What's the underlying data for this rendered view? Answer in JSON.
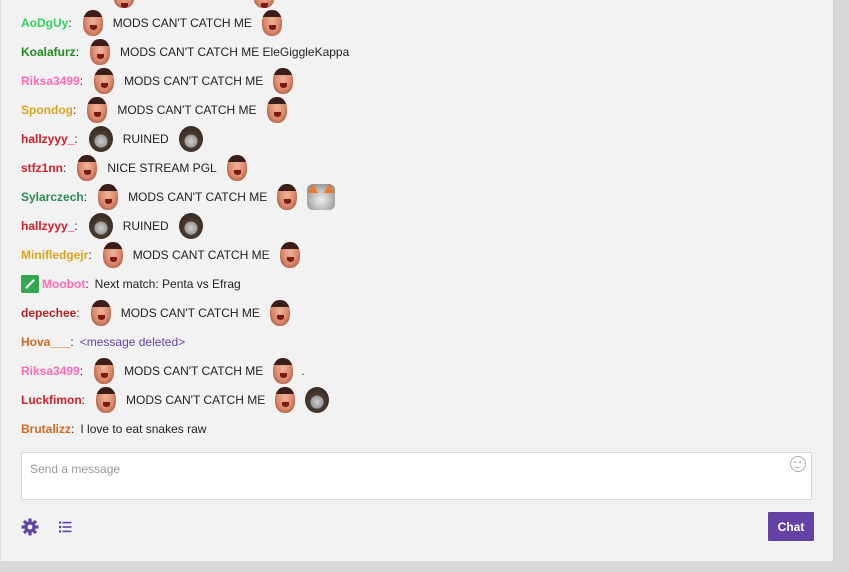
{
  "composer": {
    "placeholder": "Send a message",
    "chat_button_label": "Chat"
  },
  "messages": [
    {
      "user": "AoDgUy",
      "color": "#2fd45f",
      "text": "MODS CAN'T CATCH ME"
    },
    {
      "user": "Koalafurz",
      "color": "#1e8c1e",
      "text": "MODS CAN'T CATCH ME EleGiggleKappa"
    },
    {
      "user": "Riksa3499",
      "color": "#ff69b4",
      "text": "MODS CAN'T CATCH ME"
    },
    {
      "user": "Spondog",
      "color": "#daa520",
      "text": "MODS CAN'T CATCH ME"
    },
    {
      "user": "hallzyyy_",
      "color": "#d2202a",
      "text": "RUINED"
    },
    {
      "user": "stfz1nn",
      "color": "#d2202a",
      "text": "NICE STREAM PGL"
    },
    {
      "user": "Sylarczech",
      "color": "#2e8b57",
      "text": "MODS CAN'T CATCH ME"
    },
    {
      "user": "hallzyyy_",
      "color": "#d2202a",
      "text": "RUINED"
    },
    {
      "user": "Minifledgejr",
      "color": "#daa520",
      "text": "MODS CANT CATCH ME"
    },
    {
      "user": "Moobot",
      "color": "#ff69b4",
      "text": "Next match: Penta vs Efrag"
    },
    {
      "user": "depechee",
      "color": "#b22222",
      "text": "MODS CAN'T CATCH ME"
    },
    {
      "user": "Hova___",
      "color": "#d2691e",
      "text": "<message deleted>"
    },
    {
      "user": "Riksa3499",
      "color": "#ff69b4",
      "text": "MODS CAN'T CATCH ME"
    },
    {
      "user": "Luckfimon",
      "color": "#d2202a",
      "text": "MODS CAN'T CATCH ME"
    },
    {
      "user": "Brutalizz",
      "color": "#d2691e",
      "text": "I love to eat snakes raw"
    }
  ],
  "colors": {
    "accent": "#6441a5",
    "panel_bg": "#f2f2f2",
    "page_bg": "#d8d8d8"
  },
  "icons": {
    "settings": "gear-icon",
    "list": "list-icon",
    "emoticons": "smiley-icon",
    "moderator_badge": "sword-badge-icon"
  }
}
